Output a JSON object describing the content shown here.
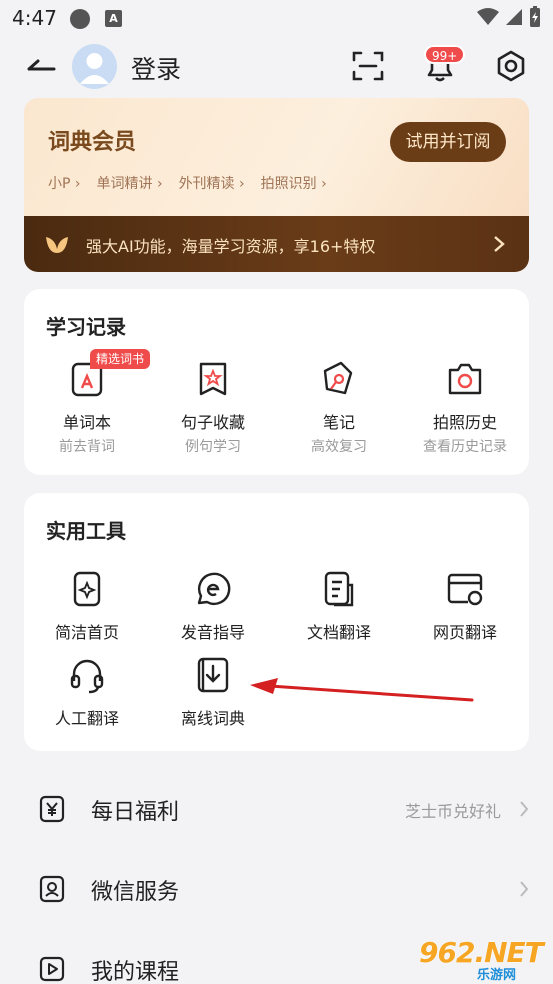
{
  "status_bar": {
    "time": "4:47",
    "notif_badge": "A"
  },
  "header": {
    "login_label": "登录",
    "notif_count": "99+"
  },
  "vip": {
    "title": "词典会员",
    "button": "试用并订阅",
    "links": [
      "小P ›",
      "单词精讲 ›",
      "外刊精读 ›",
      "拍照识别 ›"
    ],
    "banner": "强大AI功能，海量学习资源，享16+特权"
  },
  "study": {
    "title": "学习记录",
    "tag": "精选词书",
    "items": [
      {
        "label": "单词本",
        "sub": "前去背词"
      },
      {
        "label": "句子收藏",
        "sub": "例句学习"
      },
      {
        "label": "笔记",
        "sub": "高效复习"
      },
      {
        "label": "拍照历史",
        "sub": "查看历史记录"
      }
    ]
  },
  "tools": {
    "title": "实用工具",
    "items": [
      {
        "label": "简洁首页"
      },
      {
        "label": "发音指导"
      },
      {
        "label": "文档翻译"
      },
      {
        "label": "网页翻译"
      },
      {
        "label": "人工翻译"
      },
      {
        "label": "离线词典"
      }
    ]
  },
  "list": [
    {
      "label": "每日福利",
      "value": "芝士币兑好礼"
    },
    {
      "label": "微信服务",
      "value": ""
    },
    {
      "label": "我的课程",
      "value": ""
    }
  ],
  "watermark": {
    "number": "962.NET",
    "site": "乐游网"
  },
  "colors": {
    "accent": "#6b3d17",
    "badge": "#f04b4b",
    "annotation_arrow": "#d42020"
  }
}
